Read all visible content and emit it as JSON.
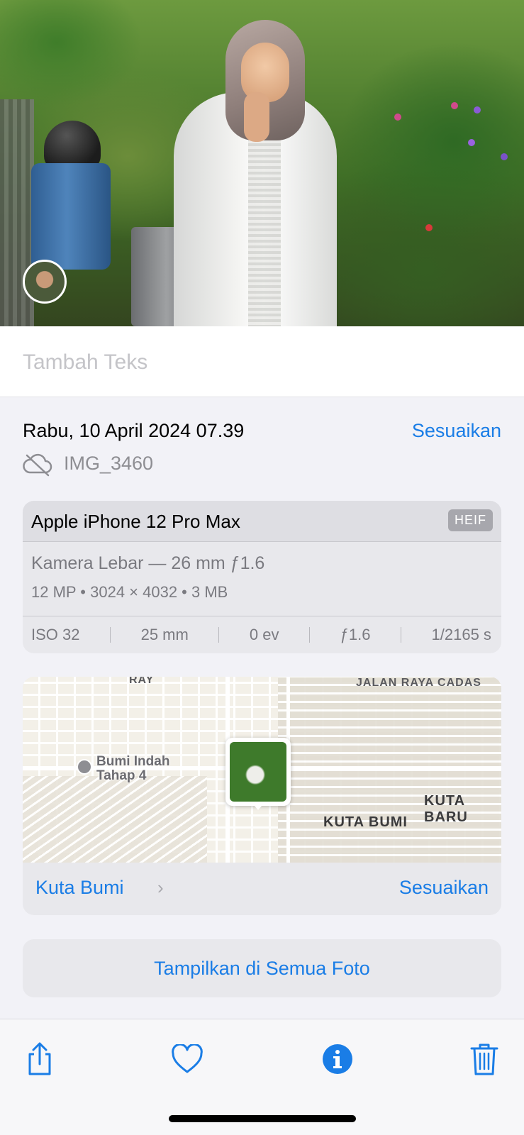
{
  "caption": {
    "placeholder": "Tambah Teks"
  },
  "info": {
    "datetime": "Rabu, 10 April 2024 07.39",
    "adjust_label": "Sesuaikan",
    "filename": "IMG_3460",
    "icons": {
      "cloud": "cloud-slash-icon"
    }
  },
  "camera": {
    "device": "Apple iPhone 12 Pro Max",
    "format_badge": "HEIF",
    "lens": "Kamera Lebar — 26 mm ƒ1.6",
    "specs": "12 MP  •  3024 × 4032  •  3 MB",
    "exif": {
      "iso": "ISO 32",
      "focal": "25 mm",
      "ev": "0 ev",
      "aperture": "ƒ1.6",
      "shutter": "1/2165 s"
    }
  },
  "map": {
    "labels": {
      "road_top_left": "RAY",
      "road_top_right": "JALAN RAYA CADAS",
      "poi": "Bumi Indah\nTahap 4",
      "district_1": "KUTA BUMI",
      "district_2": "KUTA BARU"
    },
    "place_link": "Kuta Bumi",
    "adjust_label": "Sesuaikan"
  },
  "show_all_button": "Tampilkan di Semua Foto",
  "toolbar": {
    "share": "share-icon",
    "favorite": "heart-icon",
    "info": "info-icon",
    "delete": "trash-icon"
  },
  "colors": {
    "accent": "#1a7de6",
    "background": "#f2f2f7",
    "card": "#e8e8ec"
  }
}
